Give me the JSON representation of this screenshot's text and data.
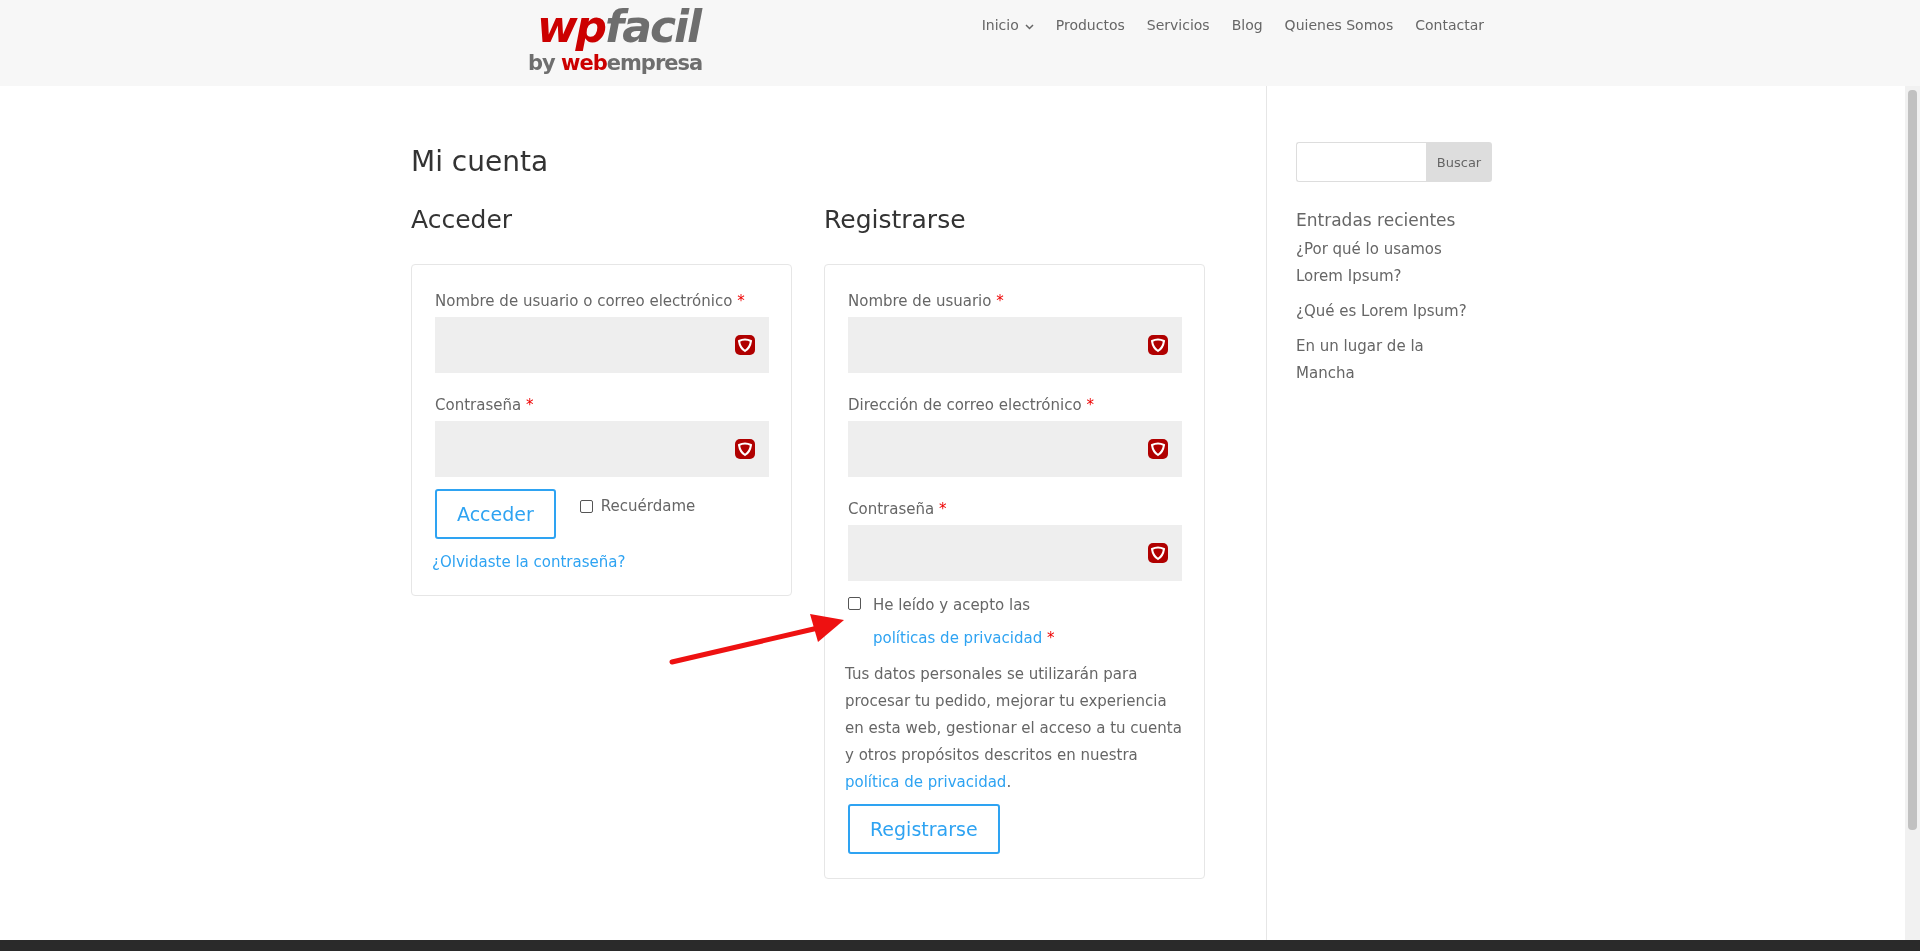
{
  "header": {
    "logo": {
      "parts": [
        {
          "text": "wp",
          "color": "#cc0000"
        },
        {
          "text": "facil",
          "color": "#6e6e6e"
        }
      ],
      "tagline": [
        {
          "text": "by ",
          "color": "#6e6e6e"
        },
        {
          "text": "web",
          "color": "#cc0000"
        },
        {
          "text": "empresa",
          "color": "#6e6e6e"
        }
      ]
    },
    "nav": [
      {
        "label": "Inicio",
        "has_dropdown": true
      },
      {
        "label": "Productos",
        "has_dropdown": false
      },
      {
        "label": "Servicios",
        "has_dropdown": false
      },
      {
        "label": "Blog",
        "has_dropdown": false
      },
      {
        "label": "Quienes Somos",
        "has_dropdown": false
      },
      {
        "label": "Contactar",
        "has_dropdown": false
      }
    ]
  },
  "page_title": "Mi cuenta",
  "login": {
    "heading": "Acceder",
    "fields": [
      {
        "label": "Nombre de usuario o correo electrónico",
        "required_mark": "*"
      },
      {
        "label": "Contraseña",
        "required_mark": "*"
      }
    ],
    "button": "Acceder",
    "remember": {
      "label": "Recuérdame",
      "checked": false
    },
    "lost_password_link": "¿Olvidaste la contraseña?"
  },
  "register": {
    "heading": "Registrarse",
    "fields": [
      {
        "label": "Nombre de usuario",
        "required_mark": "*"
      },
      {
        "label": "Dirección de correo electrónico",
        "required_mark": "*"
      },
      {
        "label": "Contraseña",
        "required_mark": "*"
      }
    ],
    "terms": {
      "checked": false,
      "text": "He leído y acepto las",
      "link": "políticas de privacidad",
      "required_mark": "*"
    },
    "privacy_text": "Tus datos personales se utilizarán para procesar tu pedido, mejorar tu experiencia en esta web, gestionar el acceso a tu cuenta y otros propósitos descritos en nuestra",
    "privacy_link": "política de privacidad",
    "privacy_end": ".",
    "button": "Registrarse"
  },
  "sidebar": {
    "search_button": "Buscar",
    "recent_heading": "Entradas recientes",
    "recent_posts": [
      "¿Por qué lo usamos Lorem Ipsum?",
      "¿Qué es Lorem Ipsum?",
      "En un lugar de la Mancha"
    ]
  }
}
